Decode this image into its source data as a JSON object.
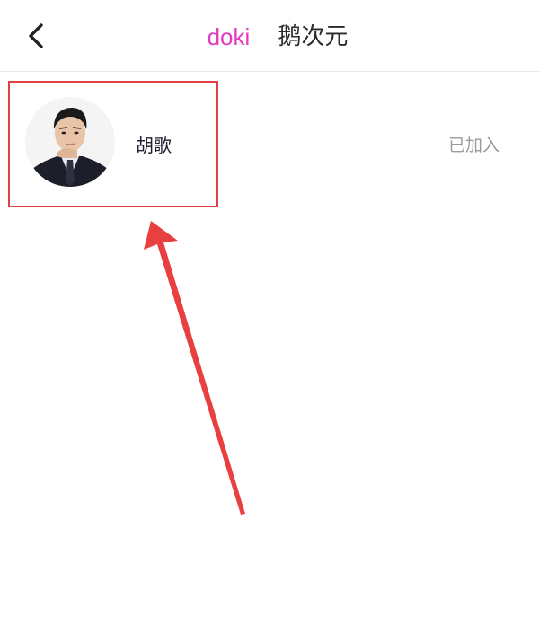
{
  "header": {
    "tabs": [
      {
        "label": "doki",
        "active": true,
        "color": "#e23ac0"
      },
      {
        "label": "鹅次元",
        "active": false,
        "color": "#2b2b2b"
      }
    ]
  },
  "list": [
    {
      "name": "胡歌",
      "status": "已加入"
    }
  ],
  "annotation": {
    "box_color": "#e04040",
    "arrow_color": "#e84040"
  }
}
